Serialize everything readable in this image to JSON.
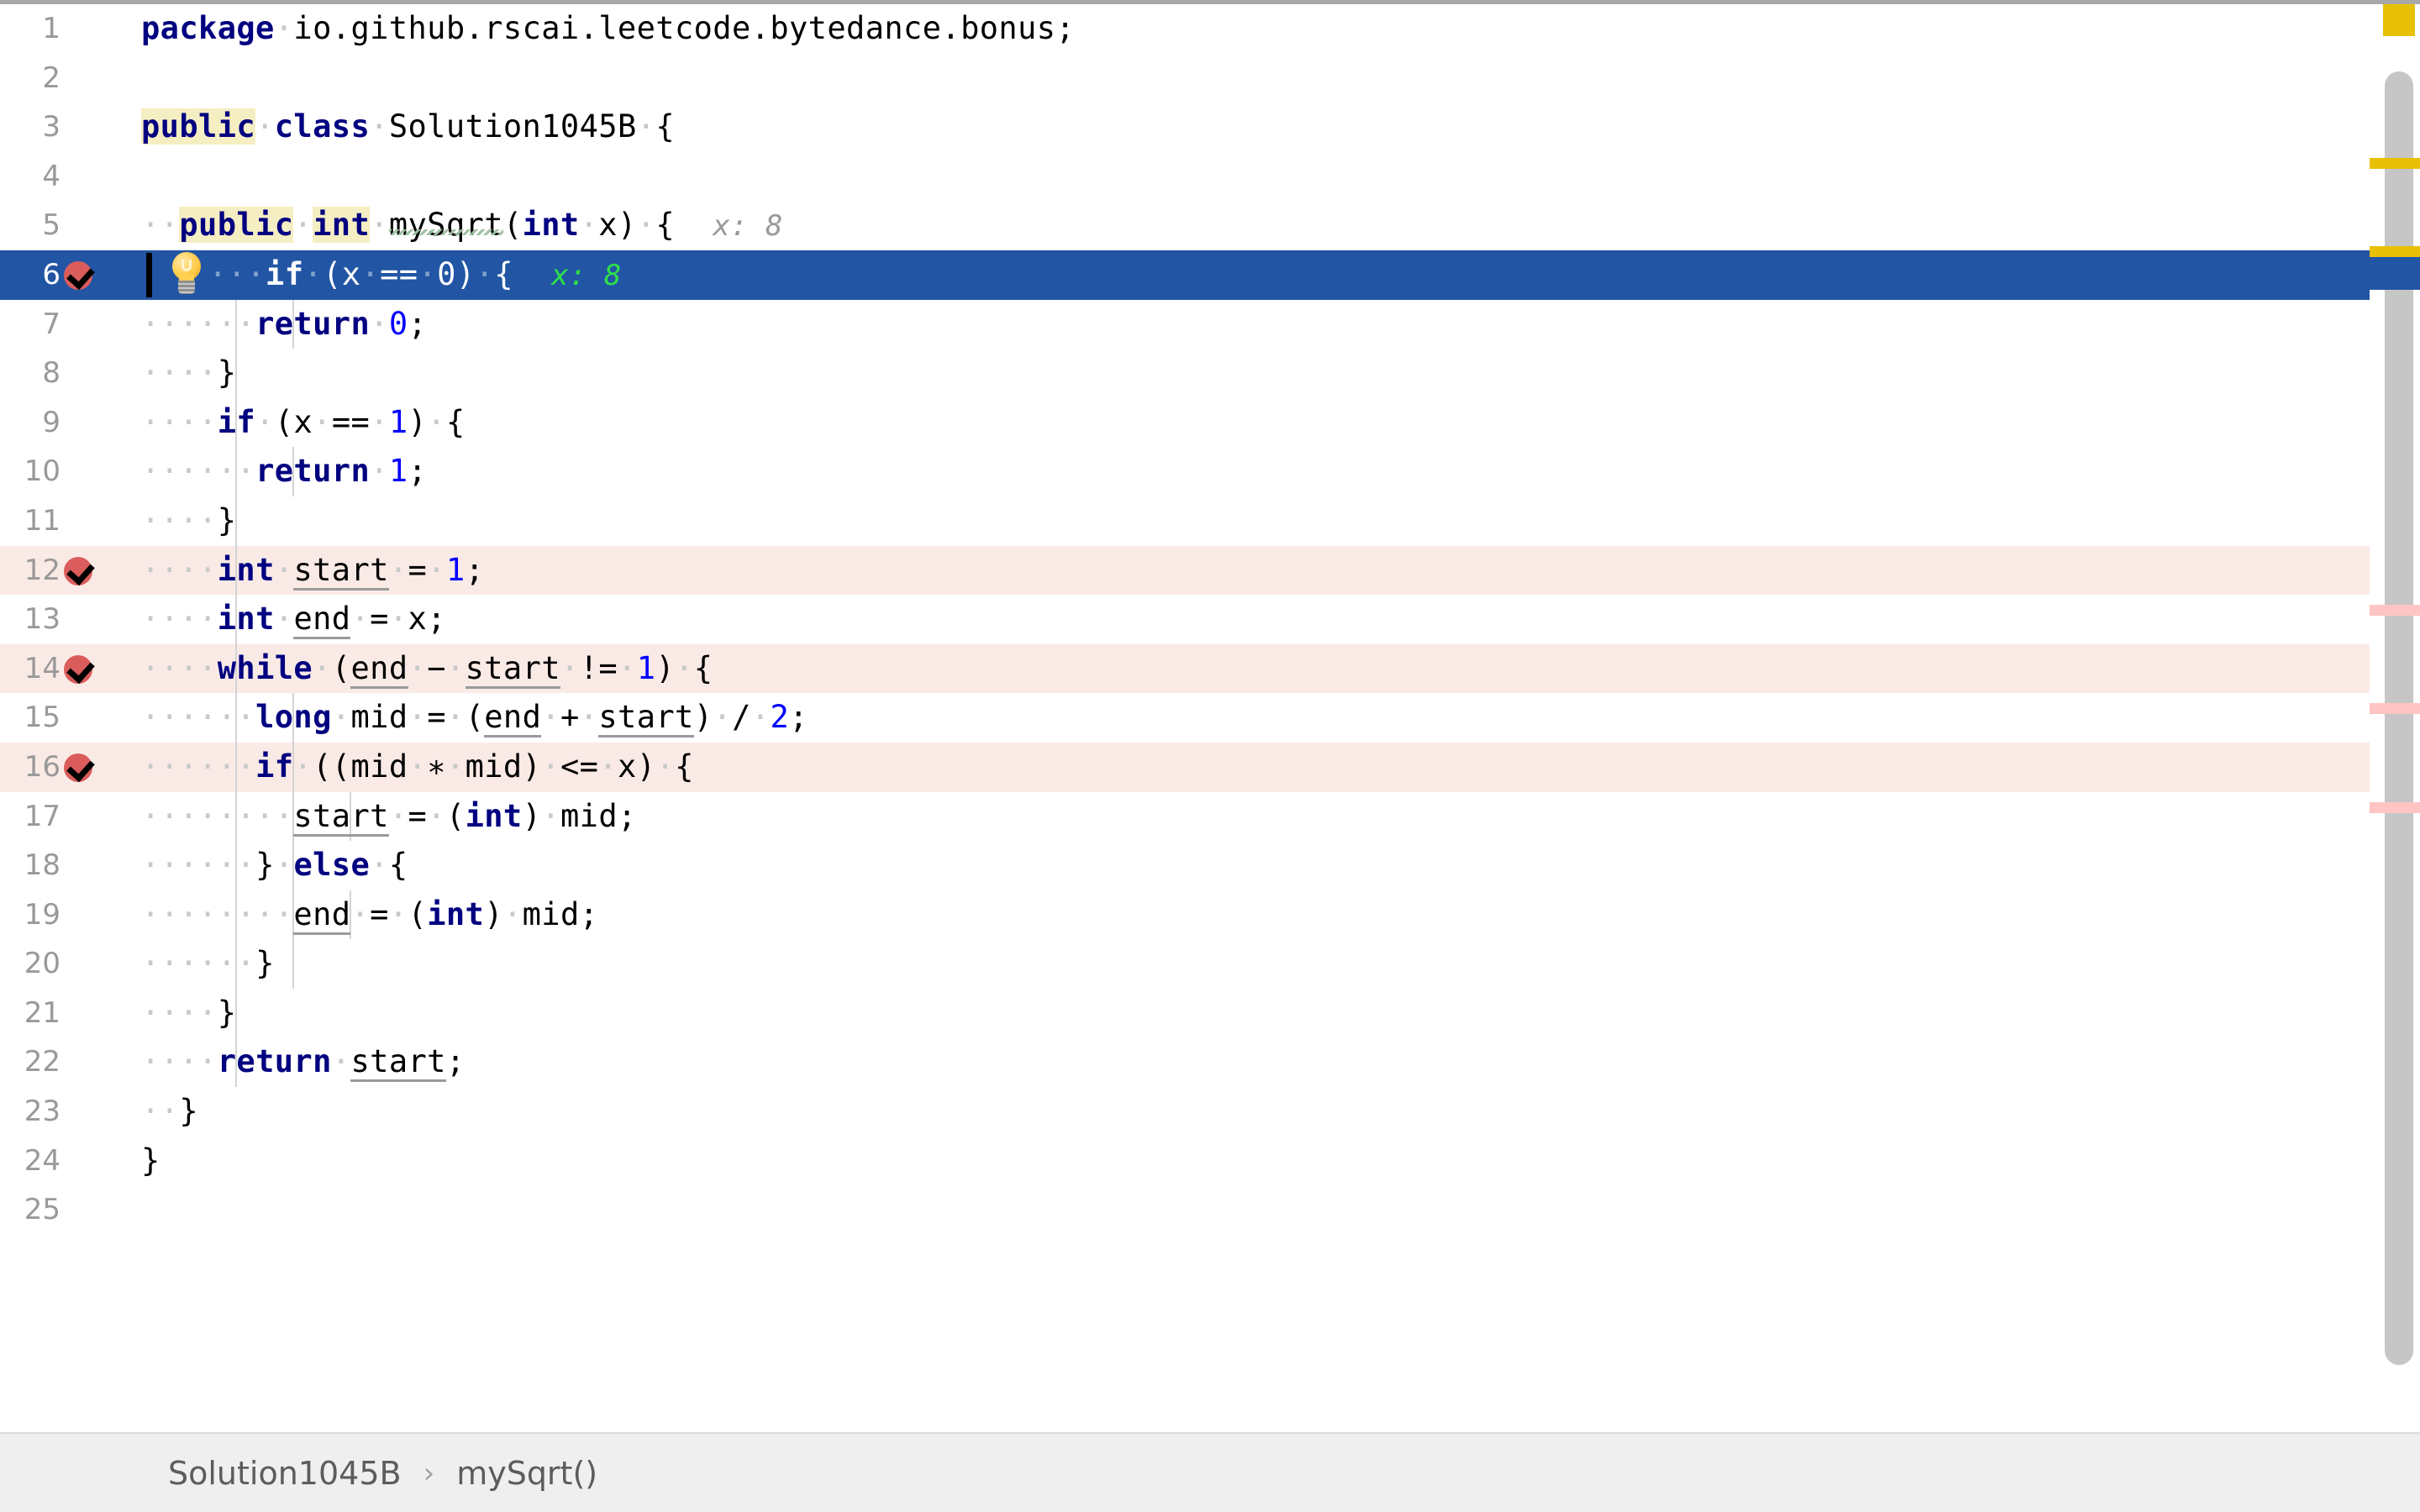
{
  "editor": {
    "language": "java",
    "selected_line": 6,
    "caret_line": 6,
    "colors": {
      "selection": "#2255a4",
      "breakpoint_line": "#faeae6",
      "keyword": "#000080",
      "number": "#0000ff",
      "local_variable_underline": "#9a9a9a",
      "identifier_highlight": "#f5eec3",
      "inline_hint": "#9a9a9a",
      "inline_hint_active": "#2fe04a",
      "gutter_number": "#999999",
      "breakpoint": "#db5c5c",
      "typo_squiggle": "#9cc09c",
      "inspection_widget": "#e8c007"
    },
    "lines": [
      {
        "n": "1",
        "indent": 0,
        "breakpoint": false,
        "text": "package io.github.rscai.leetcode.bytedance.bonus;"
      },
      {
        "n": "2",
        "indent": 0,
        "breakpoint": false,
        "text": ""
      },
      {
        "n": "3",
        "indent": 0,
        "breakpoint": false,
        "text": "public class Solution1045B {"
      },
      {
        "n": "4",
        "indent": 0,
        "breakpoint": false,
        "text": ""
      },
      {
        "n": "5",
        "indent": 1,
        "breakpoint": false,
        "text": "public int mySqrt(int x) {",
        "hint": "x: 8"
      },
      {
        "n": "6",
        "indent": 2,
        "breakpoint": true,
        "text": "if (x == 0) {",
        "hint": "x: 8",
        "selected": true
      },
      {
        "n": "7",
        "indent": 3,
        "breakpoint": false,
        "text": "return 0;"
      },
      {
        "n": "8",
        "indent": 2,
        "breakpoint": false,
        "text": "}"
      },
      {
        "n": "9",
        "indent": 2,
        "breakpoint": false,
        "text": "if (x == 1) {"
      },
      {
        "n": "10",
        "indent": 3,
        "breakpoint": false,
        "text": "return 1;"
      },
      {
        "n": "11",
        "indent": 2,
        "breakpoint": false,
        "text": "}"
      },
      {
        "n": "12",
        "indent": 2,
        "breakpoint": true,
        "text": "int start = 1;"
      },
      {
        "n": "13",
        "indent": 2,
        "breakpoint": false,
        "text": "int end = x;"
      },
      {
        "n": "14",
        "indent": 2,
        "breakpoint": true,
        "text": "while (end - start != 1) {"
      },
      {
        "n": "15",
        "indent": 3,
        "breakpoint": false,
        "text": "long mid = (end + start) / 2;"
      },
      {
        "n": "16",
        "indent": 3,
        "breakpoint": true,
        "text": "if ((mid * mid) <= x) {"
      },
      {
        "n": "17",
        "indent": 4,
        "breakpoint": false,
        "text": "start = (int) mid;"
      },
      {
        "n": "18",
        "indent": 3,
        "breakpoint": false,
        "text": "} else {"
      },
      {
        "n": "19",
        "indent": 4,
        "breakpoint": false,
        "text": "end = (int) mid;"
      },
      {
        "n": "20",
        "indent": 3,
        "breakpoint": false,
        "text": "}"
      },
      {
        "n": "21",
        "indent": 2,
        "breakpoint": false,
        "text": "}"
      },
      {
        "n": "22",
        "indent": 2,
        "breakpoint": false,
        "text": "return start;"
      },
      {
        "n": "23",
        "indent": 1,
        "breakpoint": false,
        "text": "}"
      },
      {
        "n": "24",
        "indent": 0,
        "breakpoint": false,
        "text": "}"
      },
      {
        "n": "25",
        "indent": 0,
        "breakpoint": false,
        "text": ""
      }
    ]
  },
  "gutter_icons": {
    "breakpoint_verified": "breakpoint-verified-icon",
    "intention_bulb": "lightbulb-icon"
  },
  "rail": {
    "inspection_status": "inspection-status-widget",
    "markers": [
      {
        "type": "warn",
        "label": "warning-marker"
      },
      {
        "type": "warn",
        "label": "warning-marker"
      },
      {
        "type": "sel",
        "label": "caret-position-marker"
      },
      {
        "type": "err",
        "label": "breakpoint-marker"
      },
      {
        "type": "err",
        "label": "breakpoint-marker"
      },
      {
        "type": "err",
        "label": "breakpoint-marker"
      }
    ]
  },
  "breadcrumb": {
    "class": "Solution1045B",
    "separator": "›",
    "method": "mySqrt()"
  }
}
